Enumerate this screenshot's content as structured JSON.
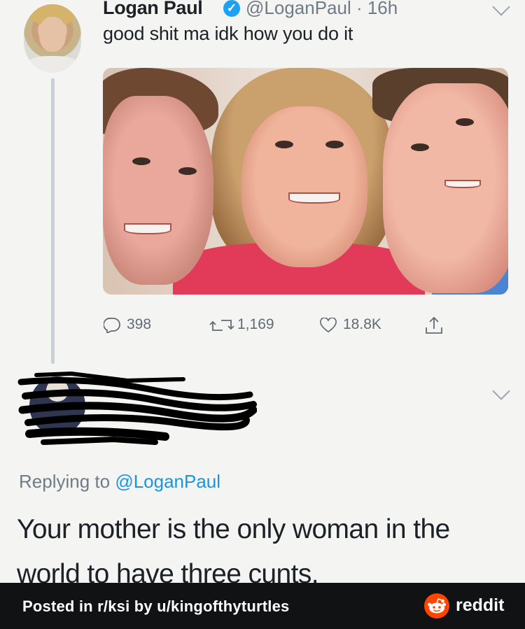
{
  "tweet": {
    "author_name": "Logan Paul",
    "verified_mark": "✓",
    "handle": "@LoganPaul",
    "separator": " · ",
    "time": "16h",
    "text": "good shit ma idk how you do it",
    "photo_alt": "photo of a woman with two teenage boys",
    "stats": {
      "replies": "398",
      "retweets": "1,169",
      "likes": "18.8K"
    }
  },
  "reply": {
    "replying_prefix": "Replying to ",
    "replying_mention": "@LoganPaul",
    "text": "Your mother is the only woman in the world to have three cunts."
  },
  "footer": {
    "posted_in": "Posted in ",
    "subreddit": "r/ksi",
    "by": " by ",
    "user": "u/kingofthyturtles",
    "brand": "reddit",
    "colors": {
      "background": "#111214",
      "brand": "#ff4500"
    }
  },
  "colors": {
    "verified": "#1da1f2",
    "mention": "#1b95e0",
    "muted": "#6f7b85"
  },
  "icons": {
    "reply": "speech-bubble-icon",
    "retweet": "retweet-arrows-icon",
    "like": "heart-icon",
    "share": "share-upload-icon",
    "menu": "chevron-down-icon"
  }
}
